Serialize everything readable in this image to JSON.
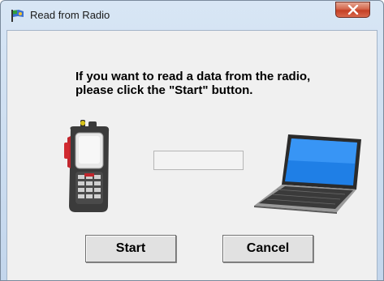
{
  "window": {
    "title": "Read from Radio",
    "close_icon": "close-icon",
    "app_icon": "radio-flag-icon"
  },
  "message": {
    "line1": "If you want to read a data from the radio,",
    "line2": "please click the \"Start\" button."
  },
  "progress": {
    "value": 0
  },
  "buttons": {
    "start_label": "Start",
    "cancel_label": "Cancel"
  },
  "illustrations": {
    "radio": "handheld-radio-icon",
    "laptop": "laptop-icon"
  },
  "colors": {
    "close_button": "#c43f24",
    "client_bg": "#f0f0f0",
    "titlebar": "#c3d6ec"
  }
}
